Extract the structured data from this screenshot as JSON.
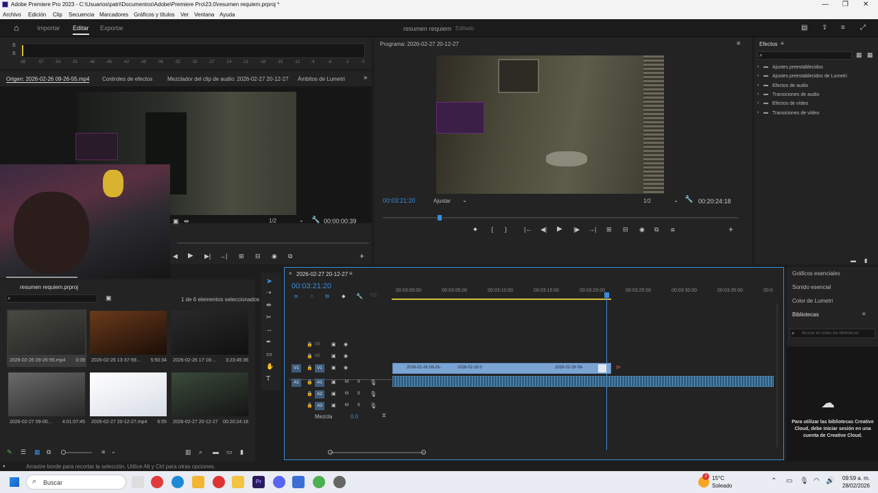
{
  "window": {
    "title": "Adobe Premiere Pro 2023 - C:\\Usuarios\\patri\\Documentos\\Adobe\\Premiere Pro\\23.0\\resumen requiem.prproj *"
  },
  "menu": [
    "Archivo",
    "Edición",
    "Clip",
    "Secuencia",
    "Marcadores",
    "Gráficos y títulos",
    "Ver",
    "Ventana",
    "Ayuda"
  ],
  "workspace": {
    "tabs": [
      "Importar",
      "Editar",
      "Exportar"
    ],
    "active": "Editar",
    "project_name": "resumen requiem",
    "project_state": "Editado"
  },
  "audio_meter": {
    "scale": [
      "dB",
      "-57",
      "-54",
      "-51",
      "-48",
      "-45",
      "-42",
      "-39",
      "-36",
      "-33",
      "-30",
      "-27",
      "-24",
      "-21",
      "-18",
      "-15",
      "-12",
      "-9",
      "-6",
      "-3",
      "0"
    ],
    "channels": [
      "S",
      "S"
    ]
  },
  "source_panel": {
    "tabs": [
      "Origen: 2026-02-26 09-26-55.mp4",
      "Controles de efectos",
      "Mezclador del clip de audio: 2026-02-27 20-12-27",
      "Ámbitos de Lumetri"
    ],
    "resolution": "1/2",
    "timecode": "00:00:00:39"
  },
  "program_panel": {
    "title": "Programa: 2026-02-27 20-12-27",
    "timecode": "00:03:21:20",
    "fit": "Ajustar",
    "resolution": "1/2",
    "duration": "00:20:24:18"
  },
  "effects_panel": {
    "title": "Efectos",
    "items": [
      "Ajustes preestablecidos",
      "Ajustes preestablecidos de Lumetri",
      "Efectos de audio",
      "Transiciones de audio",
      "Efectos de vídeo",
      "Transiciones de vídeo"
    ]
  },
  "project_panel": {
    "title": "resumen requiem.prproj",
    "selection_info": "1 de 6 elementos seleccionados",
    "items": [
      {
        "name": "2026-02-26 09-26-55.mp4",
        "duration": "0:39"
      },
      {
        "name": "2026-02-26 13-37-59...",
        "duration": "5:50:34"
      },
      {
        "name": "2026-02-26 17-16-...",
        "duration": "3:23:45:36"
      },
      {
        "name": "2026-02-27 09-00...",
        "duration": "4:01:07:45"
      },
      {
        "name": "2026-02-27 20-12-27.mp4",
        "duration": "6:55"
      },
      {
        "name": "2026-02-27 20-12-27",
        "duration": "00:20:24:18"
      }
    ]
  },
  "timeline": {
    "sequence_name": "2026-02-27 20-12-27",
    "timecode": "00:03:21:20",
    "ruler": [
      "00:03:00:00",
      "00:03:05:00",
      "00:03:10:00",
      "00:03:15:00",
      "00:03:20:00",
      "00:03:25:00",
      "00:03:30:00",
      "00:03:35:00",
      "00:0"
    ],
    "video_tracks": [
      "V3",
      "V2",
      "V1"
    ],
    "audio_tracks": [
      "A1",
      "A2",
      "A3"
    ],
    "mix_label": "Mezcla",
    "mix_value": "0.0",
    "clips": [
      "2026-02-26 09-26-",
      "2026-02-26 0",
      "2026-02-26 09-"
    ]
  },
  "right_column": {
    "items": [
      "Gráficos esenciales",
      "Sonido esencial",
      "Color de Lumetri"
    ],
    "libraries_title": "Bibliotecas",
    "search_placeholder": "Buscar en todas las bibliotecas",
    "cc_message": "Para utilizar las bibliotecas Creative Cloud, debe iniciar sesión en una cuenta de Creative Cloud."
  },
  "status_bar": {
    "text": "Arrastre borde para recortar la selección. Utilice Alt y Ctrl para otras opciones."
  },
  "taskbar": {
    "search_label": "Buscar",
    "weather_temp": "15°C",
    "weather_desc": "Soleado",
    "time": "09:59 a. m.",
    "date": "28/02/2026",
    "badge": "2"
  },
  "colors": {
    "accent_blue": "#3a8dde",
    "playhead": "#3a8dde",
    "clip_video": "#7aa4d4",
    "clip_audio": "#2d5c80"
  }
}
